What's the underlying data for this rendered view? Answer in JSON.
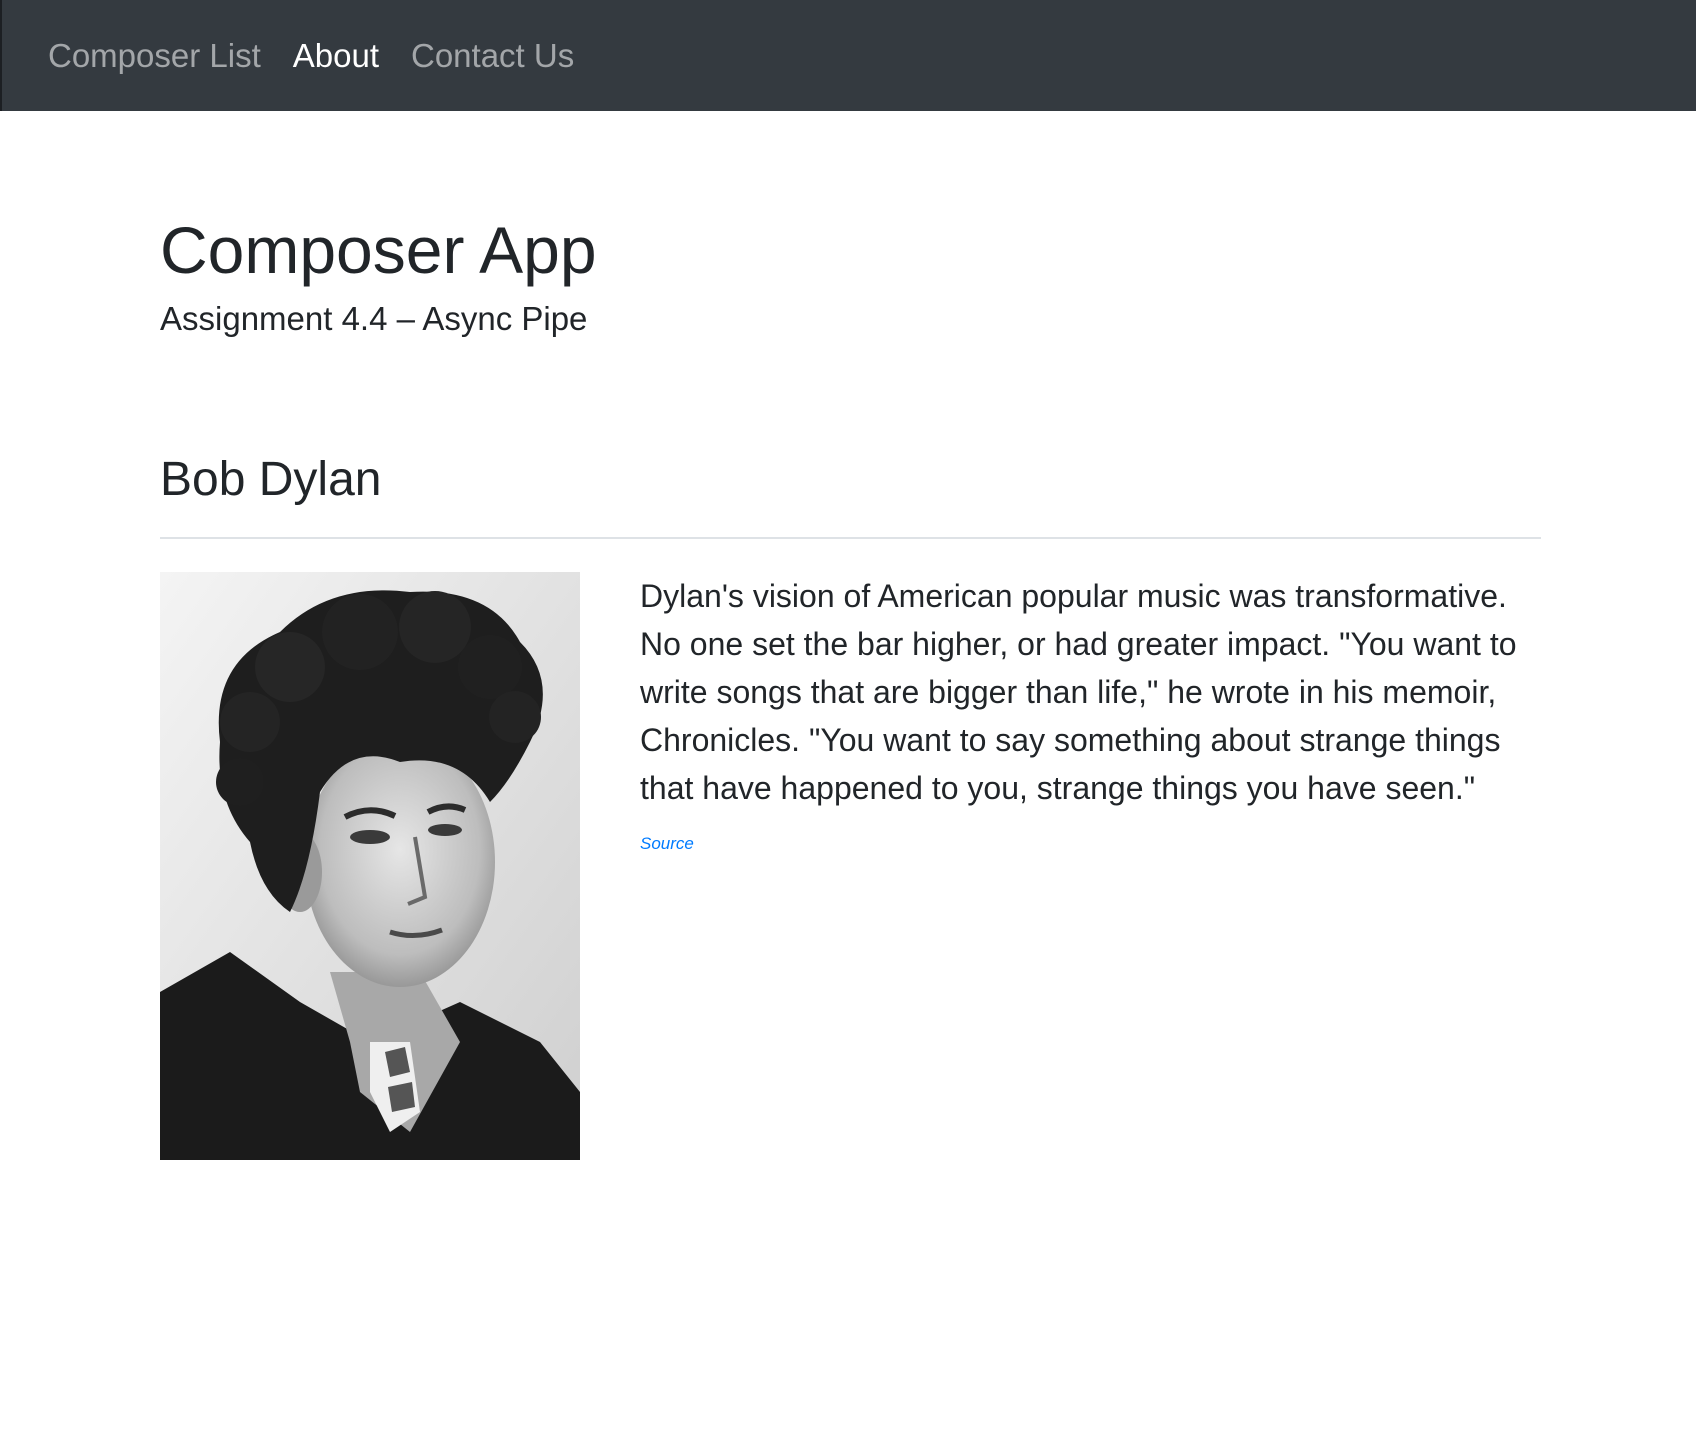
{
  "navbar": {
    "links": [
      {
        "label": "Composer List",
        "active": false
      },
      {
        "label": "About",
        "active": true
      },
      {
        "label": "Contact Us",
        "active": false
      }
    ]
  },
  "header": {
    "title": "Composer App",
    "subtitle": "Assignment 4.4 – Async Pipe"
  },
  "composer": {
    "name": "Bob Dylan",
    "bio": "Dylan's vision of American popular music was transformative. No one set the bar higher, or had greater impact. \"You want to write songs that are bigger than life,\" he wrote in his memoir, Chronicles. \"You want to say something about strange things that have happened to you, strange things you have seen.\"",
    "source_label": "Source"
  },
  "colors": {
    "navbar_bg": "#343a40",
    "link": "#007bff",
    "text": "#212529"
  }
}
